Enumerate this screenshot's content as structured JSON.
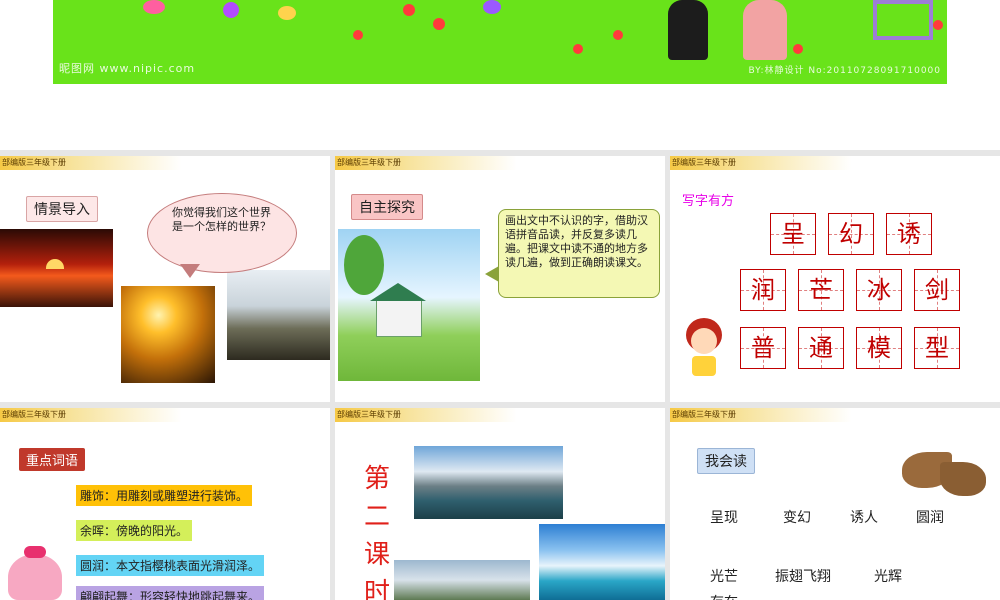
{
  "banner": {
    "watermark_left": "昵图网 www.nipic.com",
    "watermark_right": "BY:林静设计 No:20110728091710000"
  },
  "slide_header_label": "部编版三年级下册",
  "slide1": {
    "section_label": "情景导入",
    "bubble_text": "你觉得我们这个世界是一个怎样的世界？"
  },
  "slide2": {
    "section_label": "自主探究",
    "bubble_text": "画出文中不认识的字，借助汉语拼音品读，并反复多读几遍。把课文中读不通的地方多读几遍，做到正确朗读课文。"
  },
  "slide3": {
    "title": "写字有方",
    "rows": [
      [
        "呈",
        "幻",
        "诱"
      ],
      [
        "润",
        "芒",
        "冰",
        "剑"
      ],
      [
        "普",
        "通",
        "模",
        "型"
      ]
    ]
  },
  "slide4": {
    "section_label": "重点词语",
    "terms": [
      "雕饰：用雕刻或雕塑进行装饰。",
      "余晖：傍晚的阳光。",
      "圆润：本文指樱桃表面光滑润泽。",
      "翩翩起舞：形容轻快地跳起舞来。"
    ]
  },
  "slide5": {
    "vertical_title": [
      "第",
      "二",
      "课",
      "时"
    ]
  },
  "slide6": {
    "section_label": "我会读",
    "row1": [
      "呈现",
      "变幻",
      "诱人",
      "圆润"
    ],
    "row2": [
      "光芒",
      "振翅飞翔",
      "光辉"
    ],
    "row3_partial": "存在"
  },
  "colors": {
    "banner_green": "#69e31a",
    "header_gold": "#f6c945",
    "accent_red": "#c00000",
    "title_magenta": "#e800e8"
  }
}
